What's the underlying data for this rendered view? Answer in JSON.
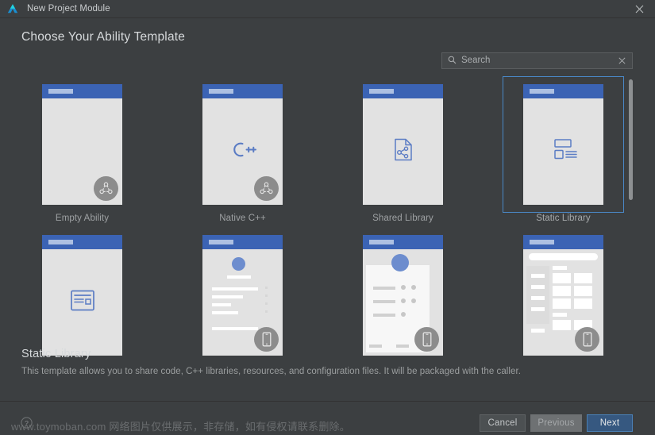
{
  "window": {
    "title": "New Project Module",
    "logo_icon": "deveco-logo-icon",
    "close_icon": "close-icon"
  },
  "page": {
    "title": "Choose Your Ability Template"
  },
  "search": {
    "placeholder": "Search",
    "value": "",
    "icon": "search-icon",
    "clear_icon": "clear-icon"
  },
  "templates": {
    "row1": [
      {
        "label": "Empty Ability",
        "icon": "none",
        "badge": "module-graph-badge-icon",
        "selected": false
      },
      {
        "label": "Native C++",
        "icon": "cpp-icon",
        "badge": "module-graph-badge-icon",
        "selected": false
      },
      {
        "label": "Shared Library",
        "icon": "shared-library-icon",
        "badge": "none",
        "selected": false
      },
      {
        "label": "Static Library",
        "icon": "static-library-icon",
        "badge": "none",
        "selected": true
      }
    ],
    "row2": [
      {
        "label": "",
        "icon": "card-layout-icon",
        "badge": "none",
        "selected": false
      },
      {
        "label": "",
        "icon": "profile-list-mockup",
        "badge": "phone-badge-icon",
        "selected": false
      },
      {
        "label": "",
        "icon": "profile-grid-mockup",
        "badge": "phone-badge-icon",
        "selected": false
      },
      {
        "label": "",
        "icon": "sidebar-grid-mockup",
        "badge": "phone-badge-icon",
        "selected": false
      }
    ]
  },
  "description": {
    "title": "Static Library",
    "text": "This template allows you to share code, C++ libraries, resources, and configuration files. It will be packaged with the caller."
  },
  "footer": {
    "help_icon": "help-icon",
    "cancel_label": "Cancel",
    "previous_label": "Previous",
    "next_label": "Next"
  },
  "watermark": {
    "text": "www.toymoban.com 网络图片仅供展示，非存储，如有侵权请联系删除。"
  },
  "colors": {
    "window_bg": "#3c3f41",
    "card_header_blue": "#3b63b4",
    "card_body": "#e2e2e2",
    "selection_border": "#4a88c7",
    "primary_button": "#365880",
    "accent_icon_blue": "#5b7cc4"
  }
}
